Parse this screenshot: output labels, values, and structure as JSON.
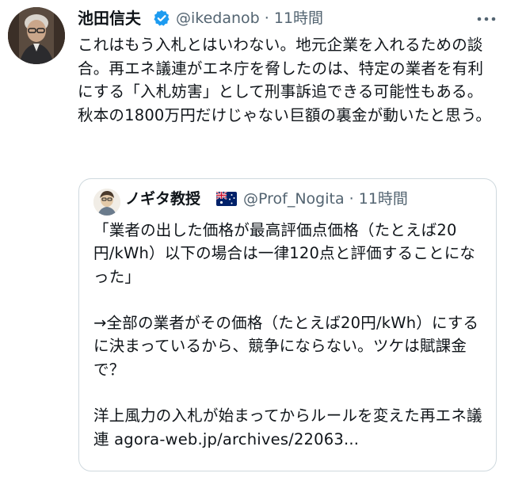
{
  "tweet": {
    "display_name": "池田信夫",
    "handle": "@ikedanob",
    "separator": " · ",
    "time": "11時間",
    "verified_icon": "verified-badge-icon",
    "more_icon": "more-options-icon",
    "text": "これはもう入札とはいわない。地元企業を入れるための談合。再エネ議連がエネ庁を脅したのは、特定の業者を有利にする「入札妨害」として刑事訴追できる可能性もある。秋本の1800万円だけじゃない巨額の裏金が動いたと思う。"
  },
  "quote": {
    "display_name": "ノギタ教授",
    "flag_icon": "australia-flag-icon",
    "handle": "@Prof_Nogita",
    "separator": " · ",
    "time": "11時間",
    "text": "「業者の出した価格が最高評価点価格（たとえば20円/kWh）以下の場合は一律120点と評価することになった」\n\n→全部の業者がその価格（たとえば20円/kWh）にするに決まっているから、競争にならない。ツケは賦課金で？\n\n洋上風力の入札が始まってからルールを変えた再エネ議連 agora-web.jp/archives/22063..."
  },
  "colors": {
    "text": "#0f1419",
    "secondary": "#536471",
    "verified": "#1d9bf0",
    "border": "#cfd9de"
  }
}
